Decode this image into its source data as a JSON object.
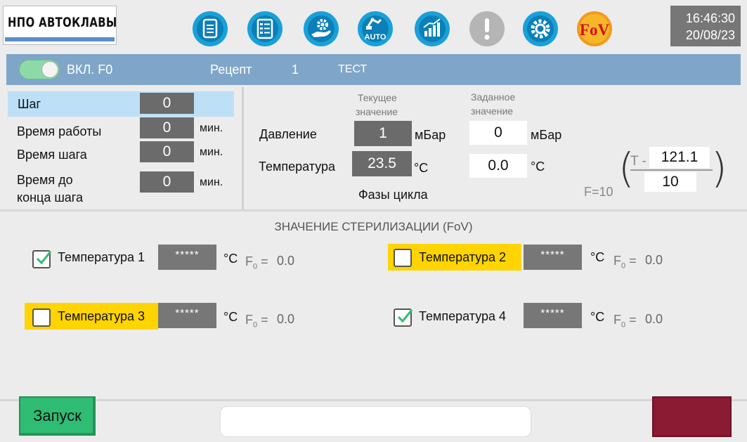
{
  "header": {
    "logo_text": "НПО АВТОКЛАВЫ",
    "time": "16:46:30",
    "date": "20/08/23",
    "icons": [
      "document-icon",
      "checklist-icon",
      "hand-gear-icon",
      "robot-auto-icon",
      "bar-chart-icon",
      "alarm-icon",
      "settings-icon",
      "fov-icon"
    ],
    "auto_label": "AUTO",
    "fov_label": "FoV"
  },
  "status_strip": {
    "toggle_label": "ВКЛ. F0",
    "recipe_label": "Рецепт",
    "recipe_number": "1",
    "recipe_name": "ТЕСТ"
  },
  "step_panel": {
    "step_label": "Шаг",
    "step_value": "0",
    "work_time_label": "Время работы",
    "work_time_value": "0",
    "work_time_unit": "мин.",
    "step_time_label": "Время шага",
    "step_time_value": "0",
    "step_time_unit": "мин.",
    "remaining_label_1": "Время до",
    "remaining_label_2": "конца шага",
    "remaining_value": "0",
    "remaining_unit": "мин."
  },
  "process": {
    "current_caption_1": "Текущее",
    "current_caption_2": "значение",
    "setpoint_caption_1": "Заданное",
    "setpoint_caption_2": "значение",
    "pressure_label": "Давление",
    "pressure_current": "1",
    "pressure_unit": "мБар",
    "pressure_setpoint": "0",
    "pressure_setpoint_unit": "мБар",
    "temperature_label": "Температура",
    "temperature_current": "23.5",
    "temperature_unit": "°C",
    "temperature_setpoint": "0.0",
    "temperature_setpoint_unit": "°C",
    "phases_label": "Фазы цикла"
  },
  "formula": {
    "base": "F=10",
    "numerator_prefix": "T -",
    "reference_temp": "121.1",
    "z_value": "10"
  },
  "sterilization": {
    "title": "ЗНАЧЕНИЕ СТЕРИЛИЗАЦИИ (FoV)",
    "f0_symbol": "F",
    "f0_sub": "0",
    "f0_eq": " =",
    "sensors": [
      {
        "label": "Температура 1",
        "checked": true,
        "highlight": false,
        "value": "*****",
        "unit": "°C",
        "f0": "0.0"
      },
      {
        "label": "Температура 2",
        "checked": false,
        "highlight": true,
        "value": "*****",
        "unit": "°C",
        "f0": "0.0"
      },
      {
        "label": "Температура 3",
        "checked": false,
        "highlight": true,
        "value": "*****",
        "unit": "°C",
        "f0": "0.0"
      },
      {
        "label": "Температура 4",
        "checked": true,
        "highlight": false,
        "value": "*****",
        "unit": "°C",
        "f0": "0.0"
      }
    ]
  },
  "footer": {
    "start_label": "Запуск",
    "message": ""
  },
  "colors": {
    "strip": "#7fa6c9",
    "start": "#2fbd73",
    "stop": "#8b1a33",
    "highlight": "#ffd400",
    "icon_blue": "#1aa0d8"
  }
}
